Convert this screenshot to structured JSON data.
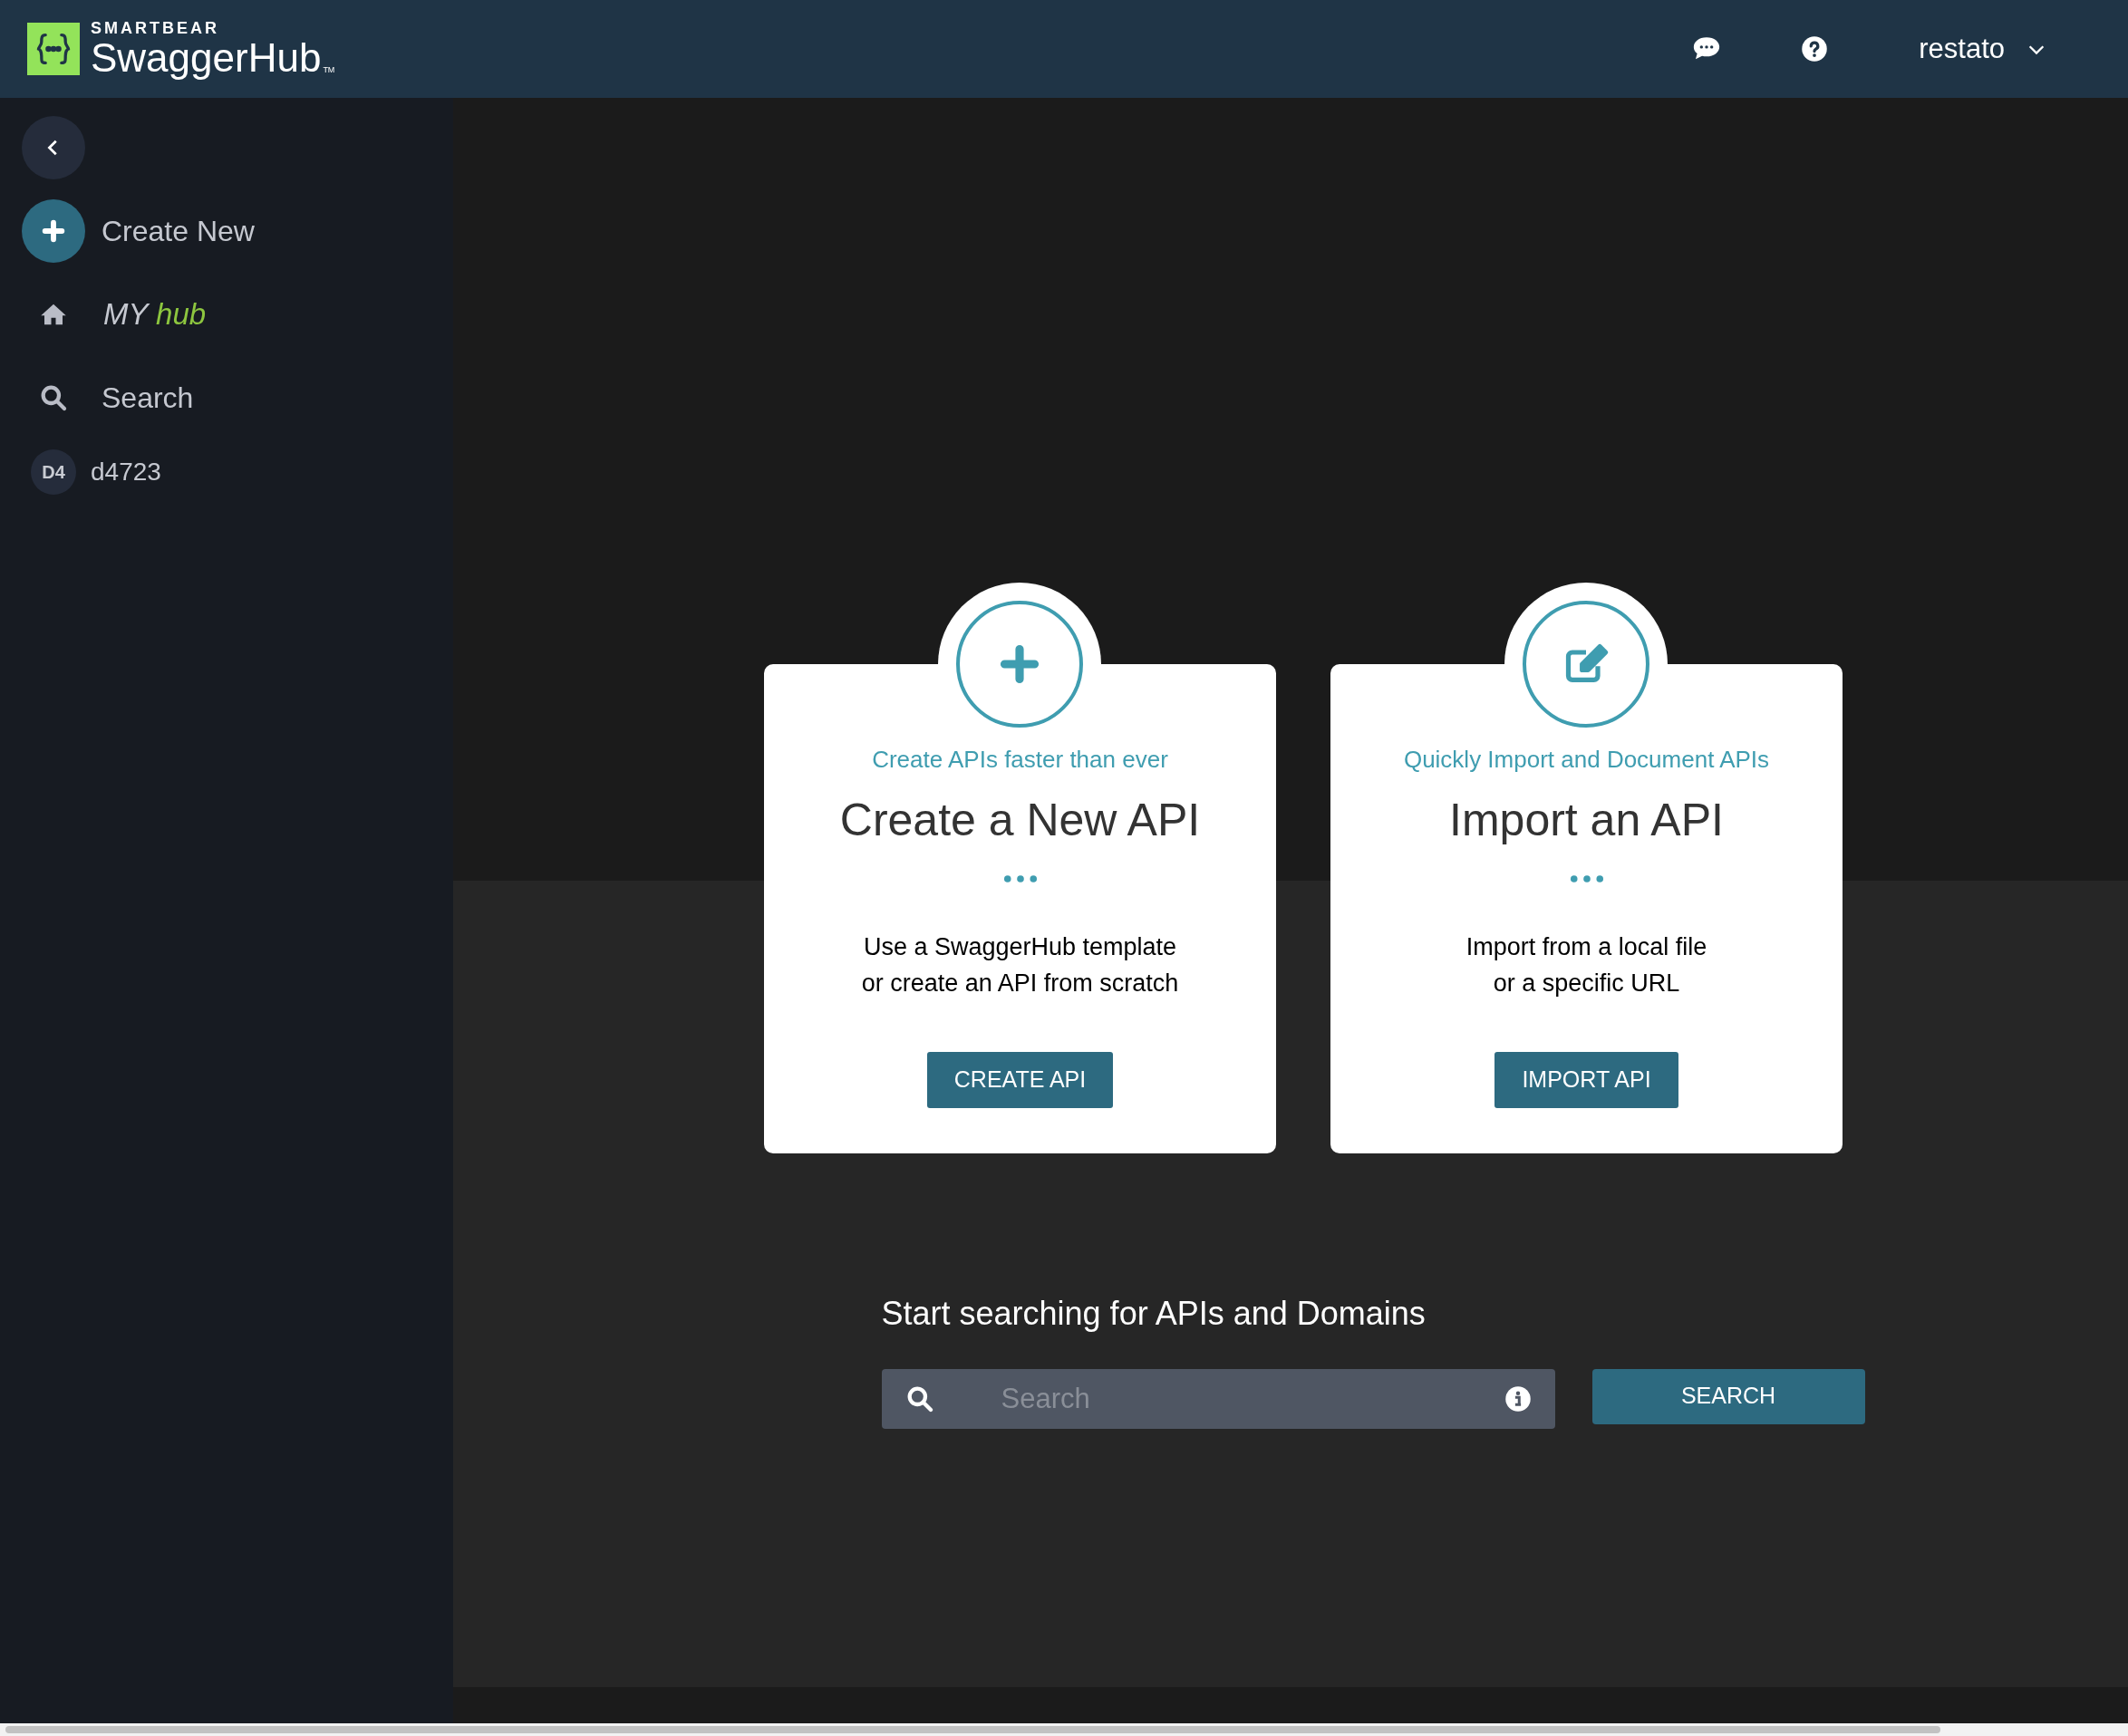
{
  "header": {
    "brand_top": "SMARTBEAR",
    "brand": "SwaggerHub",
    "trademark": "TM",
    "user": "restato"
  },
  "sidebar": {
    "items": [
      {
        "kind": "create",
        "label": "Create New"
      },
      {
        "kind": "home",
        "label": "MY",
        "accent": "hub"
      },
      {
        "kind": "search",
        "label": "Search"
      },
      {
        "kind": "org",
        "badge": "D4",
        "label": "d4723"
      }
    ]
  },
  "cards": [
    {
      "kind": "create",
      "tagline": "Create APIs faster than ever",
      "title": "Create a New API",
      "description": [
        "Use a SwaggerHub template",
        "or create an API from scratch"
      ],
      "button": "CREATE API"
    },
    {
      "kind": "import",
      "tagline": "Quickly Import and Document APIs",
      "title": "Import an API",
      "description": [
        "Import from a local file",
        "or a specific URL"
      ],
      "button": "IMPORT API"
    }
  ],
  "search": {
    "heading": "Start searching for APIs and Domains",
    "placeholder": "Search",
    "button": "SEARCH"
  }
}
